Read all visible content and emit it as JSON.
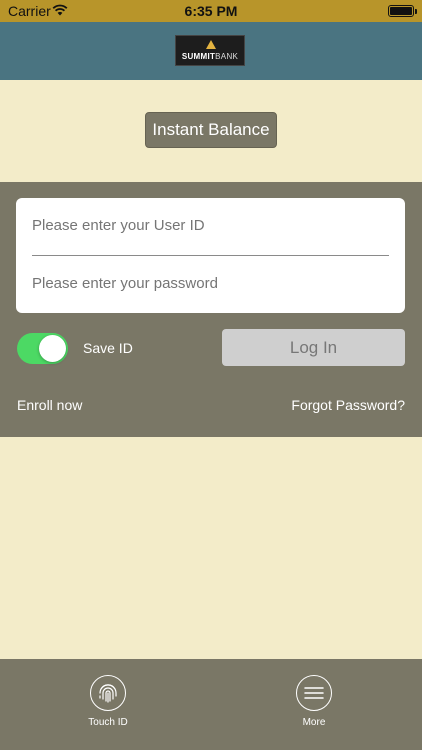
{
  "status_bar": {
    "carrier": "Carrier",
    "time": "6:35 PM"
  },
  "header": {
    "logo_text_a": "SUMMIT",
    "logo_text_b": "BANK"
  },
  "instant_balance": {
    "label": "Instant Balance"
  },
  "login": {
    "user_id_placeholder": "Please enter your User ID",
    "password_placeholder": "Please enter your password",
    "save_id_label": "Save ID",
    "save_id_on": true,
    "login_label": "Log In",
    "enroll_label": "Enroll now",
    "forgot_label": "Forgot Password?"
  },
  "tab_bar": {
    "touch_id_label": "Touch ID",
    "more_label": "More"
  },
  "colors": {
    "status_bar": "#b8952a",
    "nav_bar": "#4a7481",
    "background": "#f3ecc9",
    "panel": "#7a7766",
    "toggle_on": "#4cd964"
  }
}
